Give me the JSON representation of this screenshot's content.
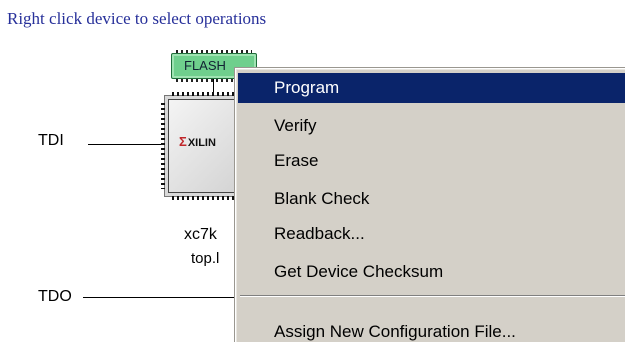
{
  "instruction": "Right click device to select operations",
  "chain": {
    "tdi_label": "TDI",
    "tdo_label": "TDO"
  },
  "flash": {
    "label": "FLASH"
  },
  "fpga": {
    "logo_text": "XILIN",
    "device_name": "xc7k",
    "file_name": "top.l"
  },
  "context_menu": {
    "items": [
      {
        "label": "Program",
        "selected": true
      },
      {
        "label": "Verify"
      },
      {
        "label": "Erase"
      },
      {
        "label": "Blank Check"
      },
      {
        "label": "Readback..."
      },
      {
        "label": "Get Device Checksum"
      },
      {
        "label": "Assign New Configuration File..."
      }
    ]
  },
  "colors": {
    "instruction_text": "#27309a",
    "menu_selected_bg": "#0a246a",
    "menu_bg": "#d4d0c8",
    "flash_chip": "#6fcf8d"
  }
}
